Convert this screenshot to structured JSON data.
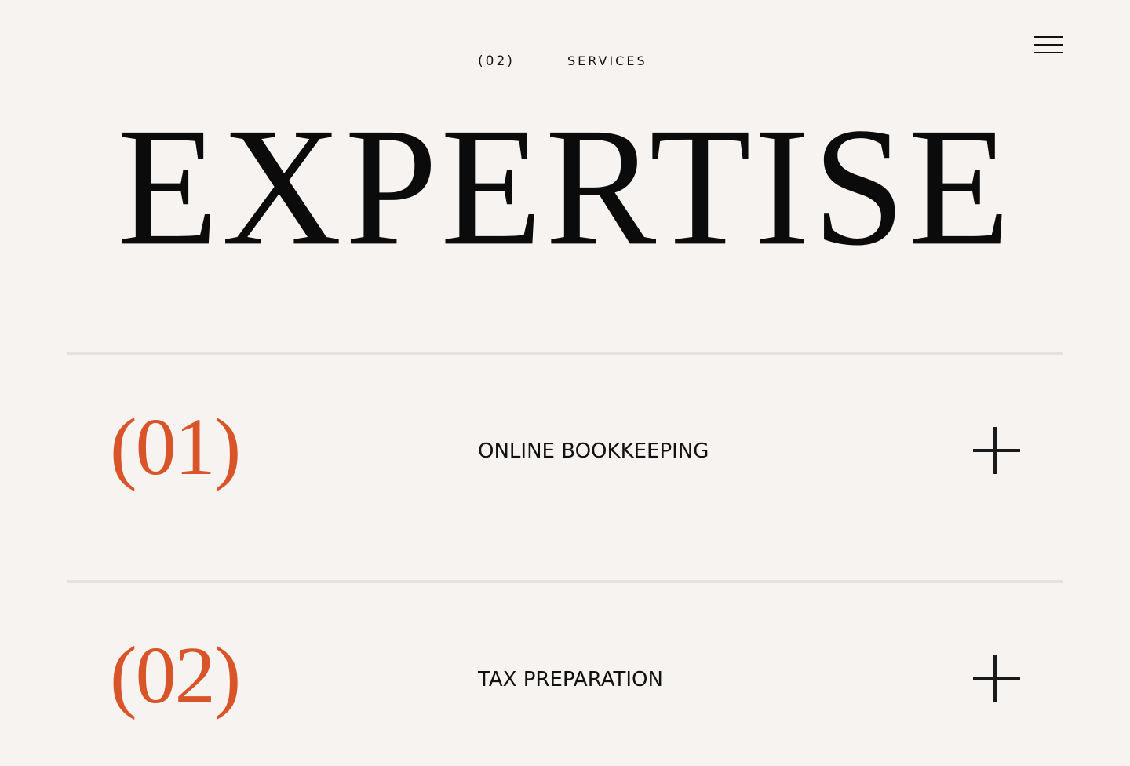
{
  "header": {
    "section_number": "(02)",
    "section_name": "SERVICES",
    "menu_icon": "hamburger-menu-icon"
  },
  "hero": {
    "title": "EXPERTISE"
  },
  "services": [
    {
      "index": "(01)",
      "name": "ONLINE BOOKKEEPING",
      "toggle_icon": "plus-icon"
    },
    {
      "index": "(02)",
      "name": "TAX PREPARATION",
      "toggle_icon": "plus-icon"
    }
  ],
  "colors": {
    "background": "#f6f3f0",
    "accent": "#d95428",
    "text": "#111111",
    "divider": "#e6e1dc"
  }
}
